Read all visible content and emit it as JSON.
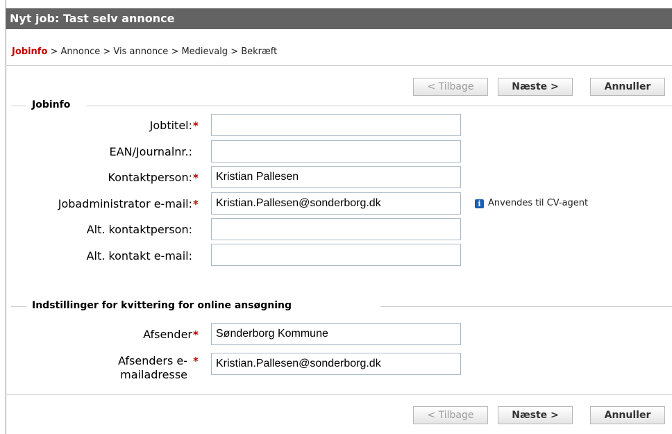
{
  "title": "Nyt job: Tast selv annonce",
  "breadcrumb": {
    "active": "Jobinfo",
    "rest": " > Annonce > Vis annonce > Medievalg > Bekræft"
  },
  "buttons": {
    "back": "< Tilbage",
    "next": "Næste >",
    "cancel": "Annuller"
  },
  "jobinfo": {
    "legend": "Jobinfo",
    "fields": {
      "jobtitle": {
        "label": "Jobtitel:",
        "value": ""
      },
      "ean": {
        "label": "EAN/Journalnr.:",
        "value": ""
      },
      "contact": {
        "label": "Kontaktperson:",
        "value": "Kristian Pallesen"
      },
      "admin_email": {
        "label": "Jobadministrator e-mail:",
        "value": "Kristian.Pallesen@sonderborg.dk"
      },
      "alt_contact": {
        "label": "Alt. kontaktperson:",
        "value": ""
      },
      "alt_email": {
        "label": "Alt. kontakt e-mail:",
        "value": ""
      }
    },
    "info_note": "Anvendes til CV-agent",
    "required_mark": "*"
  },
  "receipt": {
    "legend": "Indstillinger for kvittering for online ansøgning",
    "sender": {
      "label": "Afsender",
      "value": "Sønderborg Kommune"
    },
    "sender_email": {
      "label_line1": "Afsenders e-",
      "label_line2": "mailadresse",
      "value": "Kristian.Pallesen@sonderborg.dk"
    }
  },
  "colors": {
    "titlebar": "#636363",
    "required": "#c00000",
    "active_crumb": "#c00000",
    "info_icon": "#1b5fb1"
  }
}
